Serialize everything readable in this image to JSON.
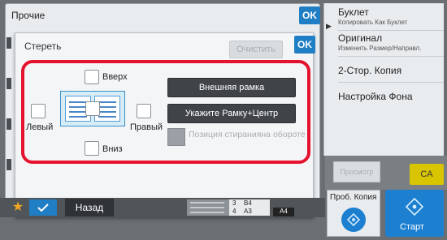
{
  "outer": {
    "title": "Прочие",
    "ok": "OK"
  },
  "dialog": {
    "title": "Стереть",
    "ok": "OK",
    "clear": "Очистить",
    "top_label": "Вверх",
    "left_label": "Левый",
    "right_label": "Правый",
    "bottom_label": "Вниз",
    "outer_frame": "Внешняя рамка",
    "frame_center": "Укажите Рамку+Центр",
    "position_label": "Позиция стиранияна обороте"
  },
  "right_panel": {
    "items": [
      {
        "main": "Буклет",
        "sub": "Копировать Как Буклет"
      },
      {
        "main": "Оригинал",
        "sub": "Изменить Размер/Направл."
      },
      {
        "main": "2-Стор. Копия",
        "sub": ""
      },
      {
        "main": "Настройка Фона",
        "sub": ""
      }
    ],
    "arrow": "▶"
  },
  "bottom": {
    "back": "Назад",
    "tray_rows": [
      {
        "num": "3",
        "size": "B4"
      },
      {
        "num": "4",
        "size": "A3"
      }
    ],
    "tray_size": "A4"
  },
  "controls": {
    "copy_preview": "Просмотр",
    "ca": "CA",
    "proof": "Проб. Копия",
    "start": "Старт"
  },
  "colors": {
    "accent": "#1f7ec4",
    "highlight": "#e4122e",
    "ca": "#d9c400"
  }
}
